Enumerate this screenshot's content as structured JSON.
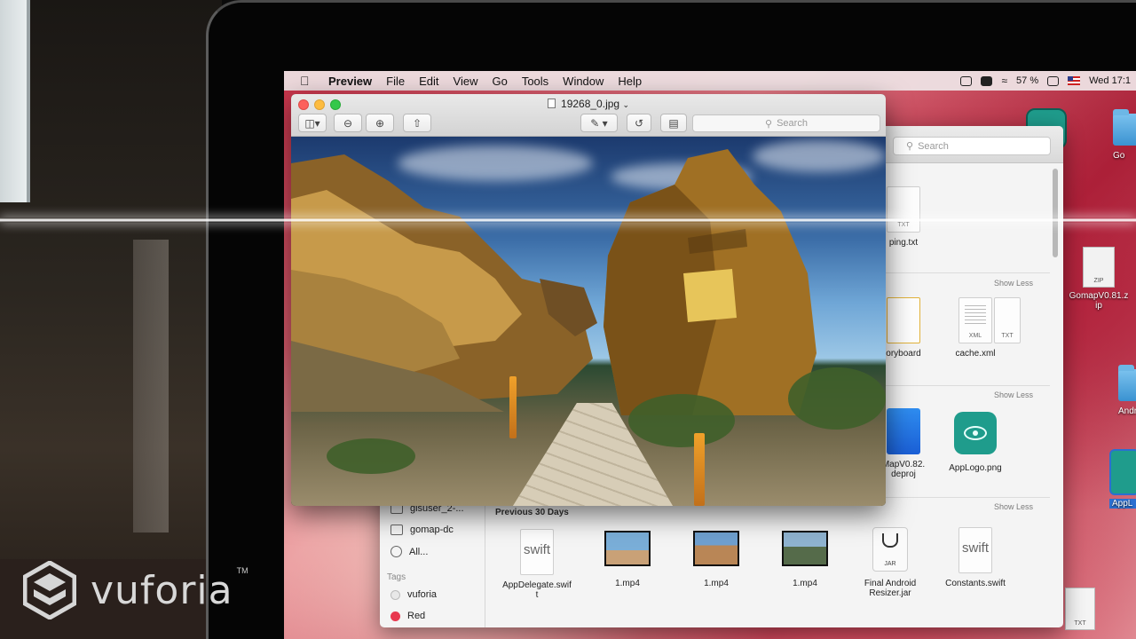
{
  "menubar": {
    "app": "Preview",
    "items": [
      "File",
      "Edit",
      "View",
      "Go",
      "Tools",
      "Window",
      "Help"
    ],
    "battery": "57 %",
    "clock": "Wed 17:1"
  },
  "preview": {
    "title": "19268_0.jpg",
    "search_placeholder": "Search"
  },
  "finder": {
    "search_placeholder": "Search",
    "show_less": "Show Less",
    "files_row1": [
      {
        "name": "ping.txt",
        "tag": "TXT"
      }
    ],
    "files_row2": [
      {
        "name": "oryboard",
        "tag": ""
      },
      {
        "name": "cache.xml",
        "tag": "XML"
      },
      {
        "name": "",
        "tag": "TXT"
      }
    ],
    "files_row3": [
      {
        "name": "MapV0.82.\ndeproj",
        "tag": ""
      },
      {
        "name": "AppLogo.png",
        "tag": ""
      }
    ],
    "sidebar": [
      {
        "label": "gisuser_2-..."
      },
      {
        "label": "gomap-dc"
      },
      {
        "label": "All..."
      }
    ],
    "tags_header": "Tags",
    "tags": [
      {
        "label": "vuforia",
        "color": "#e8e8e8"
      },
      {
        "label": "Red",
        "color": "#e8384f"
      }
    ],
    "previous_30_days": "Previous 30 Days",
    "recent_files": [
      {
        "name": "AppDelegate.swif\nt",
        "kind": "swift"
      },
      {
        "name": "1.mp4",
        "kind": "video"
      },
      {
        "name": "1.mp4",
        "kind": "video"
      },
      {
        "name": "1.mp4",
        "kind": "video"
      },
      {
        "name": "Final Android\nResizer.jar",
        "kind": "jar"
      },
      {
        "name": "Constants.swift",
        "kind": "swift"
      }
    ],
    "swift_label": "swift",
    "jar_label": "JAR"
  },
  "desktop": {
    "items": [
      {
        "label": "Go"
      },
      {
        "label": "ZIP"
      },
      {
        "label": "GomapV0.81.z\nip"
      },
      {
        "label": "Andr"
      },
      {
        "label": "AppL"
      },
      {
        "label": "TXT"
      }
    ]
  },
  "overlay": {
    "brand": "vuforia",
    "tm": "TM"
  }
}
